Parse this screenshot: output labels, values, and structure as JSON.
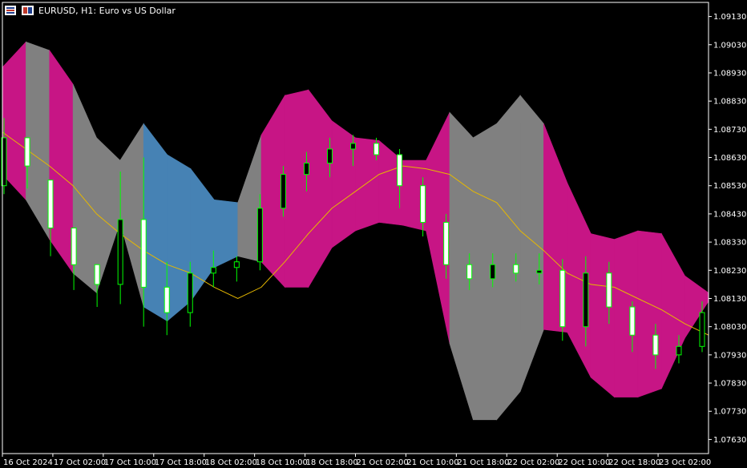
{
  "header": {
    "symbol_title": "EURUSD, H1:  Euro vs US Dollar",
    "icons": [
      "chart-grid-icon",
      "window-tile-icon"
    ]
  },
  "colors": {
    "background": "#000000",
    "frame": "#ffffff",
    "band_magenta": "#c71585",
    "band_gray": "#808080",
    "band_blue": "#4682b4",
    "ma_line": "#e6b800",
    "candle_outline": "#00ff00",
    "candle_bull_body": "#000000",
    "candle_bear_body": "#ffffff"
  },
  "chart_data": {
    "type": "candlestick",
    "ylim": [
      1.0758,
      1.0918
    ],
    "price_axis_labels": [
      "1.09130",
      "1.09030",
      "1.08930",
      "1.08830",
      "1.08730",
      "1.08630",
      "1.08530",
      "1.08430",
      "1.08330",
      "1.08230",
      "1.08130",
      "1.08030",
      "1.07930",
      "1.07830",
      "1.07730",
      "1.07630"
    ],
    "time_axis_labels": [
      "16 Oct 2024",
      "17 Oct 02:00",
      "17 Oct 10:00",
      "17 Oct 18:00",
      "18 Oct 02:00",
      "18 Oct 10:00",
      "18 Oct 18:00",
      "21 Oct 02:00",
      "21 Oct 10:00",
      "21 Oct 18:00",
      "22 Oct 02:00",
      "22 Oct 10:00",
      "22 Oct 18:00",
      "23 Oct 02:00"
    ],
    "bands": {
      "upper": [
        1.0895,
        1.0904,
        1.0901,
        1.0889,
        1.087,
        1.0862,
        1.0875,
        1.0864,
        1.0859,
        1.0848,
        1.0847,
        1.0871,
        1.0885,
        1.0887,
        1.0876,
        1.087,
        1.0869,
        1.0862,
        1.0862,
        1.0879,
        1.087,
        1.0875,
        1.0885,
        1.0875,
        1.0854,
        1.0836,
        1.0834,
        1.0837,
        1.0836,
        1.0821,
        1.0815
      ],
      "lower": [
        1.0857,
        1.0848,
        1.0834,
        1.0822,
        1.0815,
        1.084,
        1.081,
        1.0805,
        1.0812,
        1.0824,
        1.0828,
        1.0826,
        1.0817,
        1.0817,
        1.0831,
        1.0837,
        1.084,
        1.0839,
        1.0837,
        1.0797,
        1.077,
        1.077,
        1.078,
        1.0802,
        1.0801,
        1.0785,
        1.0778,
        1.0778,
        1.0781,
        1.0799,
        1.0812
      ],
      "segment_colors": [
        "magenta",
        "gray",
        "magenta",
        "gray",
        "gray",
        "gray",
        "blue",
        "blue",
        "blue",
        "blue",
        "gray",
        "magenta",
        "magenta",
        "magenta",
        "magenta",
        "magenta",
        "magenta",
        "magenta",
        "magenta",
        "gray",
        "gray",
        "gray",
        "gray",
        "magenta",
        "magenta",
        "magenta",
        "magenta",
        "magenta",
        "magenta",
        "magenta"
      ]
    },
    "ma": [
      1.0872,
      1.0866,
      1.086,
      1.0853,
      1.0843,
      1.0836,
      1.083,
      1.0825,
      1.0822,
      1.0817,
      1.0813,
      1.0817,
      1.0826,
      1.0836,
      1.0845,
      1.0851,
      1.0857,
      1.086,
      1.0859,
      1.0857,
      1.0851,
      1.0847,
      1.0837,
      1.083,
      1.0822,
      1.0818,
      1.0817,
      1.0813,
      1.0809,
      1.0804,
      1.08
    ],
    "candles": [
      {
        "o": 1.0853,
        "h": 1.0877,
        "l": 1.085,
        "c": 1.087
      },
      {
        "o": 1.087,
        "h": 1.0866,
        "l": 1.0852,
        "c": 1.086
      },
      {
        "o": 1.0855,
        "h": 1.0848,
        "l": 1.0828,
        "c": 1.0838
      },
      {
        "o": 1.0838,
        "h": 1.0834,
        "l": 1.0816,
        "c": 1.0825
      },
      {
        "o": 1.0825,
        "h": 1.0824,
        "l": 1.081,
        "c": 1.0818
      },
      {
        "o": 1.0818,
        "h": 1.0858,
        "l": 1.0811,
        "c": 1.0841
      },
      {
        "o": 1.0841,
        "h": 1.0863,
        "l": 1.0803,
        "c": 1.0817
      },
      {
        "o": 1.0817,
        "h": 1.0826,
        "l": 1.08,
        "c": 1.0808
      },
      {
        "o": 1.0808,
        "h": 1.0826,
        "l": 1.0803,
        "c": 1.0822
      },
      {
        "o": 1.0822,
        "h": 1.083,
        "l": 1.0817,
        "c": 1.0824
      },
      {
        "o": 1.0824,
        "h": 1.0828,
        "l": 1.0819,
        "c": 1.0826
      },
      {
        "o": 1.0826,
        "h": 1.085,
        "l": 1.0823,
        "c": 1.0845
      },
      {
        "o": 1.0845,
        "h": 1.086,
        "l": 1.0842,
        "c": 1.0857
      },
      {
        "o": 1.0857,
        "h": 1.0865,
        "l": 1.0851,
        "c": 1.0861
      },
      {
        "o": 1.0861,
        "h": 1.087,
        "l": 1.0856,
        "c": 1.0866
      },
      {
        "o": 1.0866,
        "h": 1.0871,
        "l": 1.086,
        "c": 1.0868
      },
      {
        "o": 1.0868,
        "h": 1.087,
        "l": 1.0862,
        "c": 1.0864
      },
      {
        "o": 1.0864,
        "h": 1.0866,
        "l": 1.0845,
        "c": 1.0853
      },
      {
        "o": 1.0853,
        "h": 1.0856,
        "l": 1.0835,
        "c": 1.084
      },
      {
        "o": 1.084,
        "h": 1.0843,
        "l": 1.082,
        "c": 1.0825
      },
      {
        "o": 1.0825,
        "h": 1.0829,
        "l": 1.0816,
        "c": 1.082
      },
      {
        "o": 1.082,
        "h": 1.0829,
        "l": 1.0817,
        "c": 1.0825
      },
      {
        "o": 1.0825,
        "h": 1.0829,
        "l": 1.0819,
        "c": 1.0822
      },
      {
        "o": 1.0822,
        "h": 1.0829,
        "l": 1.0818,
        "c": 1.0823
      },
      {
        "o": 1.0823,
        "h": 1.0827,
        "l": 1.0798,
        "c": 1.0803
      },
      {
        "o": 1.0803,
        "h": 1.0828,
        "l": 1.0796,
        "c": 1.0822
      },
      {
        "o": 1.0822,
        "h": 1.0826,
        "l": 1.0804,
        "c": 1.081
      },
      {
        "o": 1.081,
        "h": 1.0812,
        "l": 1.0794,
        "c": 1.08
      },
      {
        "o": 1.08,
        "h": 1.0804,
        "l": 1.0788,
        "c": 1.0793
      },
      {
        "o": 1.0793,
        "h": 1.08,
        "l": 1.079,
        "c": 1.0796
      },
      {
        "o": 1.0796,
        "h": 1.0812,
        "l": 1.0794,
        "c": 1.0808
      }
    ]
  }
}
